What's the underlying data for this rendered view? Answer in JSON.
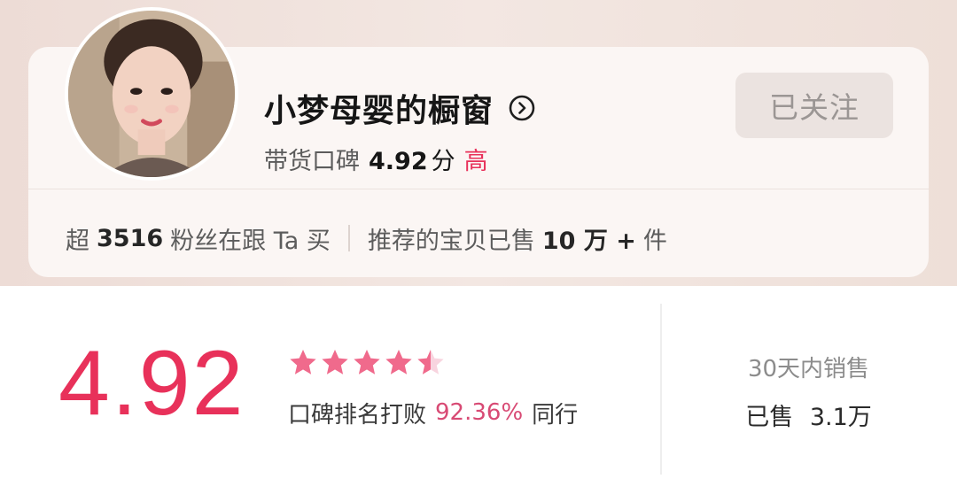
{
  "shop": {
    "name": "小梦母婴的橱窗",
    "rating_label": "带货口碑",
    "rating_score": "4.92",
    "rating_unit": "分",
    "rating_level": "高",
    "follow_label": "已关注"
  },
  "stats": {
    "fans_prefix": "超",
    "fans_count": "3516",
    "fans_suffix": "粉丝在跟 Ta 买",
    "sold_prefix": "推荐的宝贝已售",
    "sold_count": "10 万 +",
    "sold_suffix": "件"
  },
  "reputation": {
    "score": "4.92",
    "stars": 4.5,
    "rank_prefix": "口碑排名打败",
    "rank_percent": "92.36%",
    "rank_suffix": "同行"
  },
  "sales": {
    "title": "30天内销售",
    "label": "已售",
    "value": "3.1万"
  },
  "colors": {
    "accent": "#e8315a",
    "star": "#f06a8c",
    "star_empty": "#f8d4df"
  },
  "icons": {
    "name_chevron": "chevron-right-circle-icon",
    "rating_stars": "star-icon"
  }
}
